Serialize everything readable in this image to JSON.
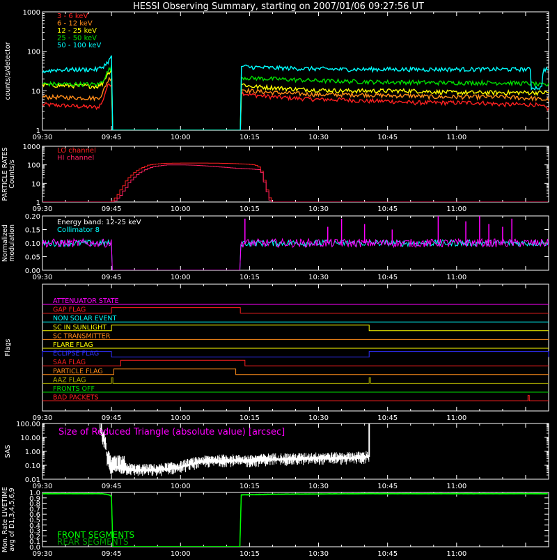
{
  "title": "HESSI Observing Summary, starting on 2007/01/06 09:27:56 UT",
  "time_ticks": [
    "09:30",
    "09:45",
    "10:00",
    "10:15",
    "10:30",
    "10:45",
    "11:00"
  ],
  "colors": {
    "bg": "#000000",
    "axis": "#ffffff",
    "red": "#ff2020",
    "orange": "#ff8c1a",
    "yellow": "#ffff00",
    "green": "#00e000",
    "cyan": "#00ffff",
    "magenta": "#ff00ff",
    "crimson": "#ff2060",
    "blue": "#3030ff",
    "olive": "#b0b000",
    "lime": "#00ff60",
    "darkgreen": "#00a000",
    "white": "#ffffff"
  },
  "chart_data": [
    {
      "type": "line",
      "name": "count-rates",
      "ylabel": "counts/s/detector",
      "yscale": "log",
      "ylim": [
        1,
        1000
      ],
      "yticks": [
        "1",
        "10",
        "100",
        "1000"
      ],
      "xlim_min": [
        0,
        110
      ],
      "legend_position": "top-left",
      "series": [
        {
          "name": "3 - 6 keV",
          "color": "#ff2020",
          "t": [
            0,
            12,
            13,
            13.5,
            14,
            14.5,
            15,
            15.1,
            43,
            43.2,
            45,
            50,
            55,
            60,
            65,
            70,
            75,
            80,
            85,
            90,
            95,
            100,
            105,
            107,
            108,
            108.6,
            110
          ],
          "v": [
            4.5,
            3.8,
            5,
            8,
            12,
            15,
            15,
            0,
            0,
            9,
            8,
            7,
            6.5,
            6,
            6,
            5.5,
            5.5,
            5,
            5,
            5,
            5,
            4.5,
            4.5,
            4.5,
            4,
            4,
            3.5
          ]
        },
        {
          "name": "6 - 12 keV",
          "color": "#ff8c1a",
          "t": [
            0,
            12,
            13,
            13.5,
            14,
            14.5,
            15,
            15.1,
            43,
            43.2,
            45,
            50,
            55,
            60,
            65,
            70,
            75,
            80,
            85,
            90,
            95,
            100,
            105,
            107,
            108,
            108.6,
            110
          ],
          "v": [
            7,
            6.5,
            8,
            12,
            16,
            20,
            22,
            0,
            0,
            11,
            10,
            9,
            8.5,
            8,
            8,
            8,
            7.5,
            7.5,
            7,
            7,
            7,
            7,
            6.5,
            6.5,
            6,
            6,
            6
          ]
        },
        {
          "name": "12 - 25 keV",
          "color": "#ffff00",
          "t": [
            0,
            12,
            13,
            13.5,
            14,
            14.5,
            15,
            15.1,
            43,
            43.2,
            45,
            50,
            55,
            60,
            65,
            70,
            75,
            80,
            85,
            90,
            95,
            100,
            105,
            107,
            108,
            108.6,
            110
          ],
          "v": [
            14,
            13,
            15,
            20,
            25,
            30,
            35,
            0,
            0,
            15,
            13,
            12,
            11,
            10.5,
            10,
            10,
            10,
            10,
            9.5,
            9,
            9,
            9,
            9,
            9,
            9,
            9,
            9
          ]
        },
        {
          "name": "25 - 50 keV",
          "color": "#00e000",
          "t": [
            0,
            12,
            13,
            13.5,
            14,
            14.5,
            15,
            15.1,
            43,
            43.2,
            45,
            50,
            55,
            60,
            65,
            70,
            75,
            80,
            85,
            90,
            95,
            100,
            105,
            107,
            108,
            108.6,
            110
          ],
          "v": [
            15,
            14.5,
            17,
            22,
            28,
            35,
            40,
            0,
            0,
            22,
            21,
            20,
            19,
            18,
            17.5,
            17,
            16.5,
            16.5,
            16,
            16,
            16,
            16,
            15.5,
            15,
            14,
            14,
            14
          ]
        },
        {
          "name": "50 - 100 keV",
          "color": "#00ffff",
          "t": [
            0,
            3,
            12,
            13,
            13.5,
            14,
            14.5,
            15,
            15.1,
            43,
            43.2,
            45,
            50,
            55,
            60,
            65,
            70,
            75,
            80,
            85,
            90,
            95,
            100,
            105,
            106,
            106.2,
            108.6,
            108.8,
            110
          ],
          "v": [
            31,
            34,
            35,
            40,
            45,
            50,
            60,
            72,
            0,
            0,
            42,
            40,
            38,
            37,
            36,
            35,
            35,
            35,
            35,
            35,
            35,
            35,
            35,
            35,
            35,
            12,
            12,
            35,
            35
          ]
        }
      ]
    },
    {
      "type": "line",
      "name": "particle-rates",
      "ylabel": "PARTICLE RATES Counts/s",
      "yscale": "log",
      "ylim": [
        1,
        1000
      ],
      "yticks": [
        "1",
        "10",
        "100",
        "1000"
      ],
      "legend_position": "top-left",
      "series": [
        {
          "name": "LO channel",
          "color": "#ff2020",
          "t": [
            0,
            14.8,
            15.5,
            16.5,
            17.5,
            19,
            21,
            23,
            26,
            30,
            35,
            40,
            44,
            46,
            47,
            47.5,
            48,
            48.5,
            49,
            49.5,
            49.7,
            110
          ],
          "v": [
            1,
            1,
            1.5,
            3,
            8,
            25,
            60,
            100,
            120,
            125,
            125,
            120,
            110,
            100,
            70,
            40,
            15,
            5,
            2,
            1.2,
            1,
            1
          ]
        },
        {
          "name": "HI channel",
          "color": "#ff2060",
          "t": [
            0,
            15.3,
            16,
            17,
            18,
            19.5,
            21.5,
            24,
            27,
            30,
            33,
            36,
            39,
            42,
            45,
            47,
            47.5,
            48,
            48.5,
            49,
            49.4,
            110
          ],
          "v": [
            1,
            1,
            1.4,
            2.5,
            6,
            18,
            45,
            80,
            100,
            100,
            95,
            85,
            75,
            65,
            60,
            55,
            35,
            12,
            4,
            1.5,
            1,
            1
          ]
        }
      ]
    },
    {
      "type": "line",
      "name": "normalized-modulation",
      "ylabel": "Normalized modulation",
      "ylim": [
        0,
        0.2
      ],
      "yticks": [
        "0.00",
        "0.05",
        "0.10",
        "0.15",
        "0.20"
      ],
      "annotations": [
        "Energy band: 12-25 keV",
        "Collimator 8"
      ],
      "segments_on": [
        [
          0,
          15
        ],
        [
          43,
          110
        ]
      ],
      "level": 0.1,
      "noise": 0.012,
      "spike_times": [
        44,
        62,
        65,
        70,
        76,
        86,
        92,
        95,
        97,
        100,
        102
      ],
      "spike_values": [
        0.19,
        0.16,
        0.19,
        0.17,
        0.15,
        0.2,
        0.18,
        0.2,
        0.17,
        0.16,
        0.19
      ]
    },
    {
      "type": "table",
      "name": "flags",
      "ylabel": "Flags",
      "rows": [
        {
          "label": "ATTENUATOR STATE",
          "color": "#ff00ff",
          "high": []
        },
        {
          "label": "GAP FLAG",
          "color": "#ff2020",
          "high": [
            [
              15,
              43
            ]
          ]
        },
        {
          "label": "NON SOLAR EVENT",
          "color": "#00ffff",
          "high": []
        },
        {
          "label": "SC IN SUNLIGHT",
          "color": "#ffff00",
          "high": [
            [
              15,
              71
            ]
          ]
        },
        {
          "label": "SC TRANSMITTER",
          "color": "#ff8c1a",
          "high": []
        },
        {
          "label": "FLARE FLAG",
          "color": "#ffff00",
          "high": []
        },
        {
          "label": "ECLIPSE FLAG",
          "color": "#3030ff",
          "high": [
            [
              0,
              15
            ],
            [
              71,
              110
            ]
          ]
        },
        {
          "label": "SAA FLAG",
          "color": "#ff2020",
          "high": [
            [
              17,
              44
            ]
          ]
        },
        {
          "label": "PARTICLE FLAG",
          "color": "#ff8c1a",
          "high": [
            [
              15.5,
              42
            ]
          ]
        },
        {
          "label": "AAZ FLAG",
          "color": "#b0b000",
          "high": [
            [
              15,
              15.3
            ],
            [
              71,
              71.3
            ]
          ]
        },
        {
          "label": "FRONTS OFF",
          "color": "#00e000",
          "high": []
        },
        {
          "label": "BAD PACKETS",
          "color": "#ff2020",
          "high": [
            [
              105.5,
              105.8
            ]
          ]
        }
      ]
    },
    {
      "type": "line",
      "name": "sas",
      "ylabel": "SAS",
      "yscale": "log",
      "ylim": [
        0.01,
        100
      ],
      "yticks": [
        "0.01",
        "0.10",
        "1.00",
        "10.00",
        "100.00"
      ],
      "annotation": "Size of Reduced Triangle (absolute value) [arcsec]",
      "t": [
        12.5,
        13,
        14,
        15,
        16,
        20,
        25,
        30,
        35,
        40,
        45,
        50,
        55,
        60,
        65,
        70,
        71,
        71.2
      ],
      "v": [
        40,
        8,
        0.2,
        0.05,
        0.08,
        0.05,
        0.05,
        0.08,
        0.2,
        0.25,
        0.22,
        0.3,
        0.3,
        0.35,
        0.35,
        0.4,
        0.5,
        100
      ]
    },
    {
      "type": "line",
      "name": "livetime",
      "ylabel": "Mon. Rate LIVETIME avg of D1,3,4,5,6,9",
      "ylim": [
        0,
        1
      ],
      "yticks": [
        "0.0",
        "0.1",
        "0.2",
        "0.3",
        "0.4",
        "0.5",
        "0.6",
        "0.7",
        "0.8",
        "0.9",
        "1.0"
      ],
      "legend_position": "bottom-left",
      "series": [
        {
          "name": "FRONT SEGMENTS",
          "color": "#00ff00",
          "t": [
            0,
            13,
            14.5,
            15,
            15.1,
            43,
            43.2,
            50,
            60,
            70,
            80,
            90,
            110
          ],
          "v": [
            0.98,
            0.98,
            0.96,
            0.93,
            0,
            0,
            0.96,
            0.97,
            0.975,
            0.98,
            0.98,
            0.98,
            0.98
          ]
        },
        {
          "name": "REAR SEGMENTS",
          "color": "#00a000",
          "t": [
            0,
            13,
            14.5,
            15,
            15.1,
            43,
            43.2,
            50,
            60,
            70,
            80,
            90,
            110
          ],
          "v": [
            0.97,
            0.97,
            0.95,
            0.92,
            0,
            0,
            0.95,
            0.96,
            0.965,
            0.97,
            0.97,
            0.97,
            0.97
          ]
        }
      ]
    }
  ]
}
